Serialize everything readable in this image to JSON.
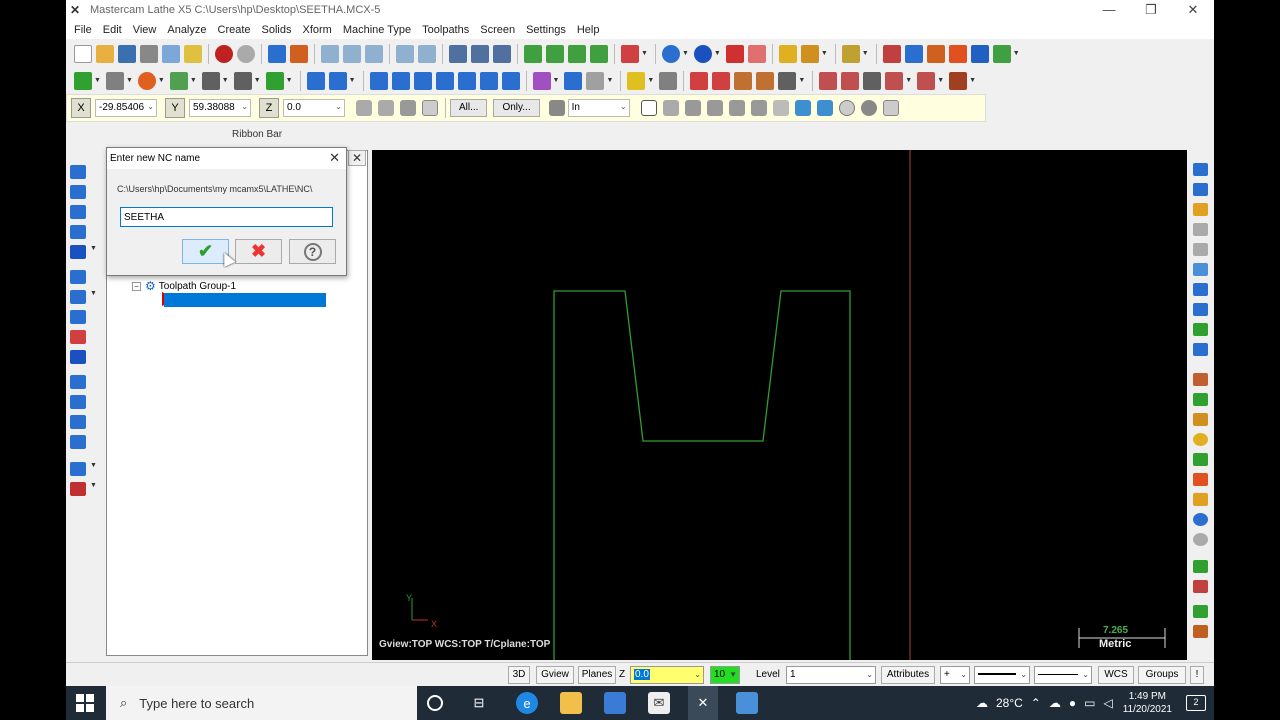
{
  "window": {
    "title": "Mastercam Lathe X5  C:\\Users\\hp\\Desktop\\SEETHA.MCX-5",
    "controls": [
      "—",
      "❐",
      "✕"
    ]
  },
  "menu": [
    "File",
    "Edit",
    "View",
    "Analyze",
    "Create",
    "Solids",
    "Xform",
    "Machine Type",
    "Toolpaths",
    "Screen",
    "Settings",
    "Help"
  ],
  "ribbon": {
    "x_label": "X",
    "x_value": "-29.85406",
    "y_label": "Y",
    "y_value": "59.38088",
    "z_label": "Z",
    "z_value": "0.0",
    "all_label": "All...",
    "only_label": "Only...",
    "mode_value": "In",
    "caption": "Ribbon Bar"
  },
  "manager": {
    "close": "✕",
    "group_label": "Toolpath Group-1"
  },
  "dialog": {
    "title": "Enter new NC name",
    "path": "C:\\Users\\hp\\Documents\\my mcamx5\\LATHE\\NC\\",
    "input_value": "SEETHA",
    "close": "✕",
    "ok_glyph": "✔",
    "cancel_glyph": "✖",
    "help_glyph": "?"
  },
  "graphics": {
    "axis_y": "Y",
    "axis_x": "X",
    "view_status": "Gview:TOP   WCS:TOP   T/Cplane:TOP",
    "scale_value": "7.265",
    "scale_unit": "Metric",
    "profile_color": "#2e9e2e",
    "axis_line_color": "#8b3a2a"
  },
  "statusbar": {
    "btn_3d": "3D",
    "btn_gview": "Gview",
    "btn_planes": "Planes",
    "z_label": "Z",
    "z_value": "0.0",
    "color_value": "10",
    "level_label": "Level",
    "level_value": "1",
    "attributes": "Attributes",
    "plus": "+",
    "wcs": "WCS",
    "groups": "Groups",
    "bang": "!"
  },
  "taskbar": {
    "search_placeholder": "Type here to search",
    "weather": "28°C",
    "time": "1:49 PM",
    "date": "11/20/2021",
    "notification": "2"
  }
}
